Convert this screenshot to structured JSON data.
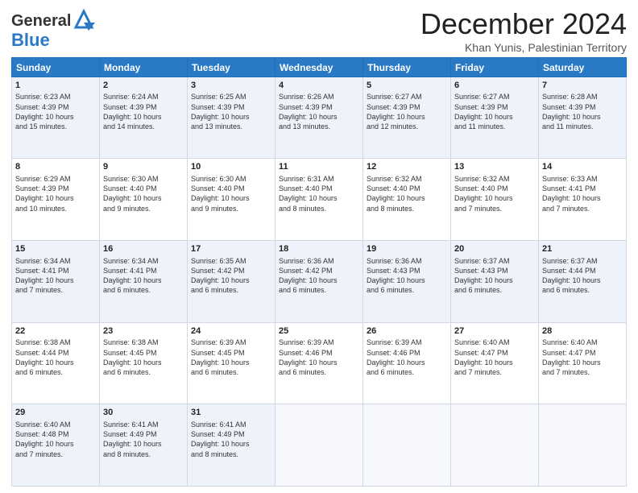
{
  "header": {
    "logo_line1": "General",
    "logo_line2": "Blue",
    "month_title": "December 2024",
    "location": "Khan Yunis, Palestinian Territory"
  },
  "days_of_week": [
    "Sunday",
    "Monday",
    "Tuesday",
    "Wednesday",
    "Thursday",
    "Friday",
    "Saturday"
  ],
  "weeks": [
    [
      {
        "day": "1",
        "info": "Sunrise: 6:23 AM\nSunset: 4:39 PM\nDaylight: 10 hours\nand 15 minutes."
      },
      {
        "day": "2",
        "info": "Sunrise: 6:24 AM\nSunset: 4:39 PM\nDaylight: 10 hours\nand 14 minutes."
      },
      {
        "day": "3",
        "info": "Sunrise: 6:25 AM\nSunset: 4:39 PM\nDaylight: 10 hours\nand 13 minutes."
      },
      {
        "day": "4",
        "info": "Sunrise: 6:26 AM\nSunset: 4:39 PM\nDaylight: 10 hours\nand 13 minutes."
      },
      {
        "day": "5",
        "info": "Sunrise: 6:27 AM\nSunset: 4:39 PM\nDaylight: 10 hours\nand 12 minutes."
      },
      {
        "day": "6",
        "info": "Sunrise: 6:27 AM\nSunset: 4:39 PM\nDaylight: 10 hours\nand 11 minutes."
      },
      {
        "day": "7",
        "info": "Sunrise: 6:28 AM\nSunset: 4:39 PM\nDaylight: 10 hours\nand 11 minutes."
      }
    ],
    [
      {
        "day": "8",
        "info": "Sunrise: 6:29 AM\nSunset: 4:39 PM\nDaylight: 10 hours\nand 10 minutes."
      },
      {
        "day": "9",
        "info": "Sunrise: 6:30 AM\nSunset: 4:40 PM\nDaylight: 10 hours\nand 9 minutes."
      },
      {
        "day": "10",
        "info": "Sunrise: 6:30 AM\nSunset: 4:40 PM\nDaylight: 10 hours\nand 9 minutes."
      },
      {
        "day": "11",
        "info": "Sunrise: 6:31 AM\nSunset: 4:40 PM\nDaylight: 10 hours\nand 8 minutes."
      },
      {
        "day": "12",
        "info": "Sunrise: 6:32 AM\nSunset: 4:40 PM\nDaylight: 10 hours\nand 8 minutes."
      },
      {
        "day": "13",
        "info": "Sunrise: 6:32 AM\nSunset: 4:40 PM\nDaylight: 10 hours\nand 7 minutes."
      },
      {
        "day": "14",
        "info": "Sunrise: 6:33 AM\nSunset: 4:41 PM\nDaylight: 10 hours\nand 7 minutes."
      }
    ],
    [
      {
        "day": "15",
        "info": "Sunrise: 6:34 AM\nSunset: 4:41 PM\nDaylight: 10 hours\nand 7 minutes."
      },
      {
        "day": "16",
        "info": "Sunrise: 6:34 AM\nSunset: 4:41 PM\nDaylight: 10 hours\nand 6 minutes."
      },
      {
        "day": "17",
        "info": "Sunrise: 6:35 AM\nSunset: 4:42 PM\nDaylight: 10 hours\nand 6 minutes."
      },
      {
        "day": "18",
        "info": "Sunrise: 6:36 AM\nSunset: 4:42 PM\nDaylight: 10 hours\nand 6 minutes."
      },
      {
        "day": "19",
        "info": "Sunrise: 6:36 AM\nSunset: 4:43 PM\nDaylight: 10 hours\nand 6 minutes."
      },
      {
        "day": "20",
        "info": "Sunrise: 6:37 AM\nSunset: 4:43 PM\nDaylight: 10 hours\nand 6 minutes."
      },
      {
        "day": "21",
        "info": "Sunrise: 6:37 AM\nSunset: 4:44 PM\nDaylight: 10 hours\nand 6 minutes."
      }
    ],
    [
      {
        "day": "22",
        "info": "Sunrise: 6:38 AM\nSunset: 4:44 PM\nDaylight: 10 hours\nand 6 minutes."
      },
      {
        "day": "23",
        "info": "Sunrise: 6:38 AM\nSunset: 4:45 PM\nDaylight: 10 hours\nand 6 minutes."
      },
      {
        "day": "24",
        "info": "Sunrise: 6:39 AM\nSunset: 4:45 PM\nDaylight: 10 hours\nand 6 minutes."
      },
      {
        "day": "25",
        "info": "Sunrise: 6:39 AM\nSunset: 4:46 PM\nDaylight: 10 hours\nand 6 minutes."
      },
      {
        "day": "26",
        "info": "Sunrise: 6:39 AM\nSunset: 4:46 PM\nDaylight: 10 hours\nand 6 minutes."
      },
      {
        "day": "27",
        "info": "Sunrise: 6:40 AM\nSunset: 4:47 PM\nDaylight: 10 hours\nand 7 minutes."
      },
      {
        "day": "28",
        "info": "Sunrise: 6:40 AM\nSunset: 4:47 PM\nDaylight: 10 hours\nand 7 minutes."
      }
    ],
    [
      {
        "day": "29",
        "info": "Sunrise: 6:40 AM\nSunset: 4:48 PM\nDaylight: 10 hours\nand 7 minutes."
      },
      {
        "day": "30",
        "info": "Sunrise: 6:41 AM\nSunset: 4:49 PM\nDaylight: 10 hours\nand 8 minutes."
      },
      {
        "day": "31",
        "info": "Sunrise: 6:41 AM\nSunset: 4:49 PM\nDaylight: 10 hours\nand 8 minutes."
      },
      null,
      null,
      null,
      null
    ]
  ]
}
